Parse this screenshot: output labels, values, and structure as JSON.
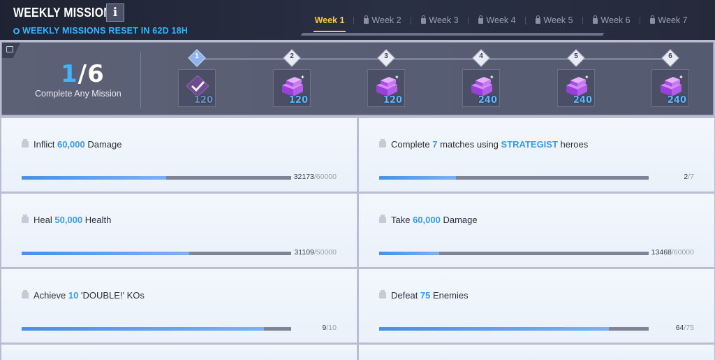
{
  "header": {
    "title": "WEEKLY MISSIONS",
    "info_label": "i",
    "reset_text": "WEEKLY MISSIONS RESET IN 62D 18H",
    "tabs": [
      {
        "label": "Week 1",
        "active": true,
        "locked": false
      },
      {
        "label": "Week 2",
        "active": false,
        "locked": true
      },
      {
        "label": "Week 3",
        "active": false,
        "locked": true
      },
      {
        "label": "Week 4",
        "active": false,
        "locked": true
      },
      {
        "label": "Week 5",
        "active": false,
        "locked": true
      },
      {
        "label": "Week 6",
        "active": false,
        "locked": true
      },
      {
        "label": "Week 7",
        "active": false,
        "locked": true
      }
    ]
  },
  "progress": {
    "completed": "1",
    "total": "/6",
    "label": "Complete Any Mission",
    "milestones": [
      {
        "num": "1",
        "done": true,
        "reward": "120",
        "reward_icon": "claimed-crystal-icon"
      },
      {
        "num": "2",
        "done": false,
        "reward": "120",
        "reward_icon": "crystal-icon"
      },
      {
        "num": "3",
        "done": false,
        "reward": "120",
        "reward_icon": "crystal-icon"
      },
      {
        "num": "4",
        "done": false,
        "reward": "240",
        "reward_icon": "crystal-icon"
      },
      {
        "num": "5",
        "done": false,
        "reward": "240",
        "reward_icon": "crystal-icon"
      },
      {
        "num": "6",
        "done": false,
        "reward": "240",
        "reward_icon": "crystal-icon"
      }
    ]
  },
  "missions": [
    {
      "pre": "Inflict ",
      "hl": "60,000",
      "post": " Damage",
      "hl2": "",
      "post2": "",
      "current": "32173",
      "max": "/60000",
      "progress": 0.536
    },
    {
      "pre": "Complete ",
      "hl": "7",
      "post": " matches using ",
      "hl2": "STRATEGIST",
      "post2": " heroes",
      "current": "2",
      "max": "/7",
      "progress": 0.286
    },
    {
      "pre": "Heal ",
      "hl": "50,000",
      "post": " Health",
      "hl2": "",
      "post2": "",
      "current": "31109",
      "max": "/50000",
      "progress": 0.622
    },
    {
      "pre": "Take ",
      "hl": "60,000",
      "post": " Damage",
      "hl2": "",
      "post2": "",
      "current": "13468",
      "max": "/60000",
      "progress": 0.224
    },
    {
      "pre": "Achieve ",
      "hl": "10",
      "post": " 'DOUBLE!' KOs",
      "hl2": "",
      "post2": "",
      "current": "9",
      "max": "/10",
      "progress": 0.9
    },
    {
      "pre": "Defeat ",
      "hl": "75",
      "post": " Enemies",
      "hl2": "",
      "post2": "",
      "current": "64",
      "max": "/75",
      "progress": 0.853
    }
  ],
  "colors": {
    "accent_blue": "#3ab4ff",
    "tab_active": "#f6c842",
    "highlight": "#3a9ae8",
    "gem": "#b35de8"
  }
}
